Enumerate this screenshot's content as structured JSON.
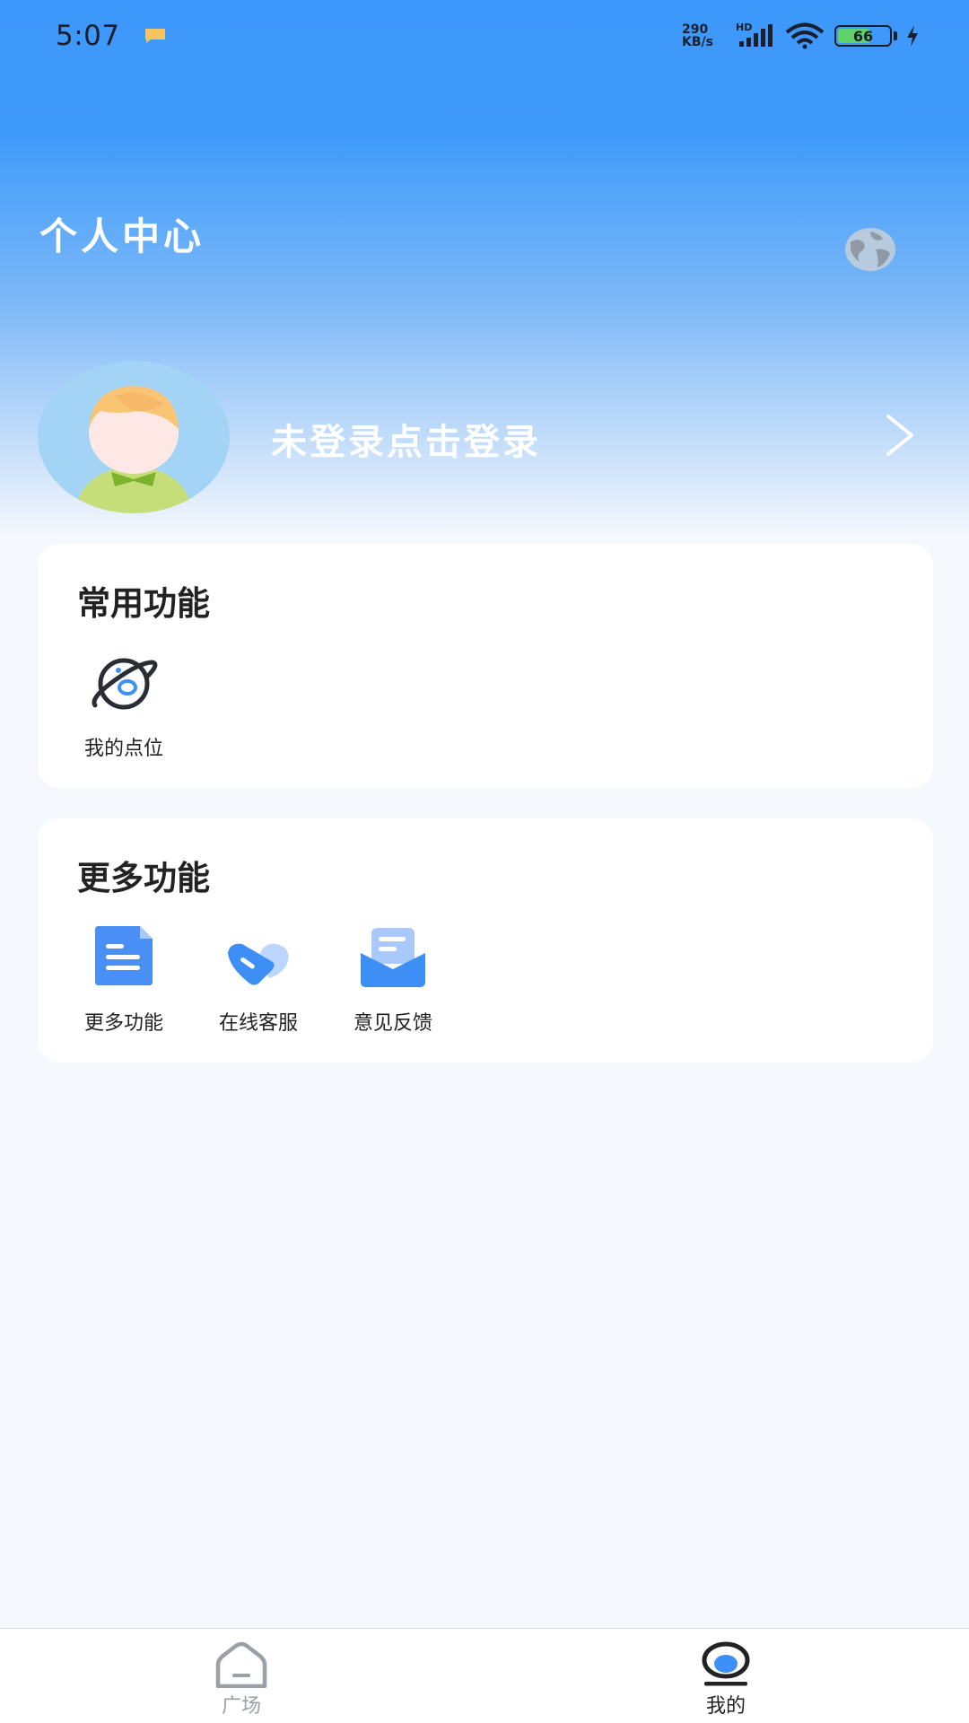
{
  "status_bar": {
    "time": "5:07",
    "net_speed_value": "290",
    "net_speed_unit": "KB/s",
    "network_type": "HD",
    "battery_level": "66",
    "battery_fraction": 0.66,
    "notification_icon": "message-icon"
  },
  "header": {
    "title": "个人中心",
    "globe_icon": "globe-icon"
  },
  "profile": {
    "login_prompt": "未登录点击登录",
    "avatar_icon": "avatar-cartoon",
    "chevron_icon": "chevron-right-icon"
  },
  "common_features": {
    "title": "常用功能",
    "items": [
      {
        "label": "我的点位",
        "icon": "planet-location-icon"
      }
    ]
  },
  "more_features": {
    "title": "更多功能",
    "items": [
      {
        "label": "更多功能",
        "icon": "document-icon"
      },
      {
        "label": "在线客服",
        "icon": "heart-chat-icon"
      },
      {
        "label": "意见反馈",
        "icon": "mail-icon"
      }
    ]
  },
  "bottom_nav": {
    "items": [
      {
        "label": "广场",
        "icon": "home-icon",
        "active": false
      },
      {
        "label": "我的",
        "icon": "profile-icon",
        "active": true
      }
    ],
    "active_color": "#222222",
    "inactive_color": "#9aa0a6"
  },
  "colors": {
    "brand_blue": "#3d98fb",
    "icon_blue": "#4a8ff5",
    "page_background": "#f5f8fd"
  }
}
